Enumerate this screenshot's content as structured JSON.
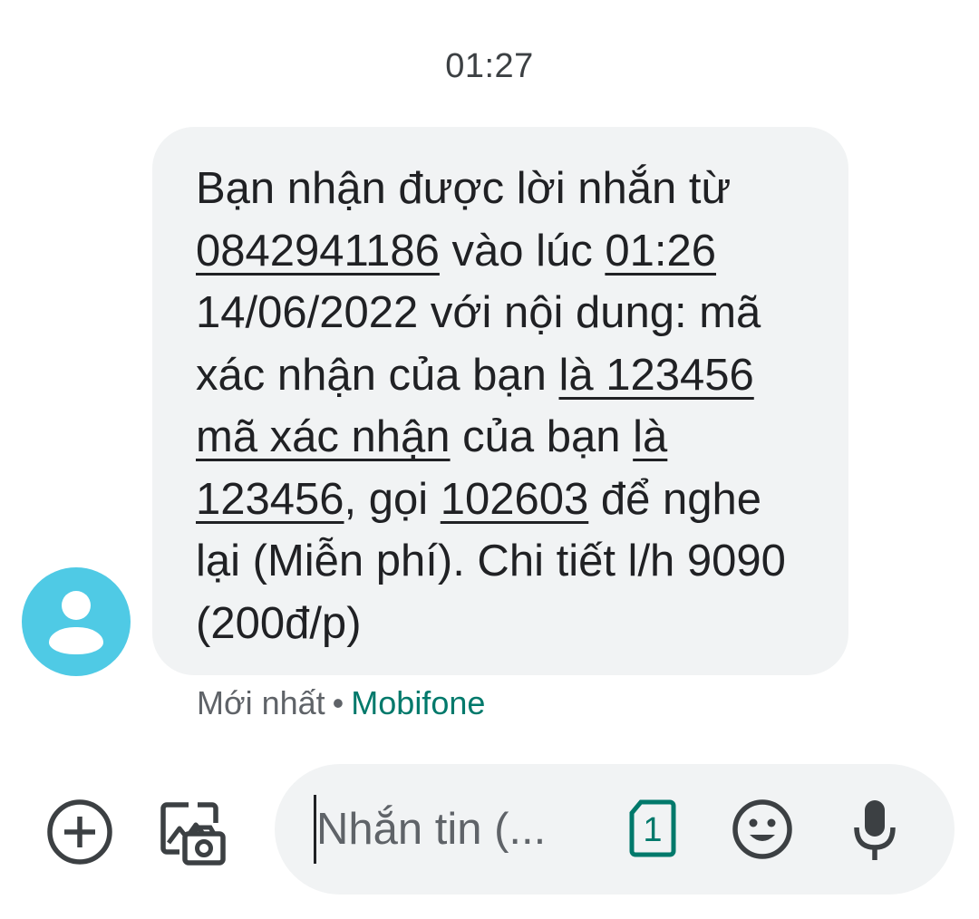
{
  "conversation": {
    "timestamp": "01:27"
  },
  "message": {
    "segments": [
      {
        "text": "Bạn nhận được lời nhắn từ ",
        "link": false
      },
      {
        "text": "0842941186",
        "link": true
      },
      {
        "text": " vào lúc ",
        "link": false
      },
      {
        "text": "01:26",
        "link": true
      },
      {
        "text": " 14/06/2022 với nội dung: mã xác nhận của bạn ",
        "link": false
      },
      {
        "text": "là 123456 mã xác nhận",
        "link": true
      },
      {
        "text": " của bạn ",
        "link": false
      },
      {
        "text": "là 123456",
        "link": true
      },
      {
        "text": ", gọi ",
        "link": false
      },
      {
        "text": "102603",
        "link": true
      },
      {
        "text": " để nghe lại (Miễn phí). Chi tiết l/h 9090 (200đ/p)",
        "link": false
      }
    ],
    "status": "Mới nhất",
    "separator": "•",
    "sim_label": "Mobifone"
  },
  "compose": {
    "placeholder": "Nhắn tin (...",
    "sim_slot": "1"
  },
  "icons": {
    "add": "add-circle-icon",
    "media": "add-photo-icon",
    "sim": "sim-card-icon",
    "emoji": "emoji-icon",
    "mic": "microphone-icon",
    "avatar": "person-icon"
  },
  "colors": {
    "bubble": "#f1f3f4",
    "avatar": "#4fcae5",
    "accent": "#00796b",
    "text": "#202124",
    "secondary": "#5f6368"
  }
}
